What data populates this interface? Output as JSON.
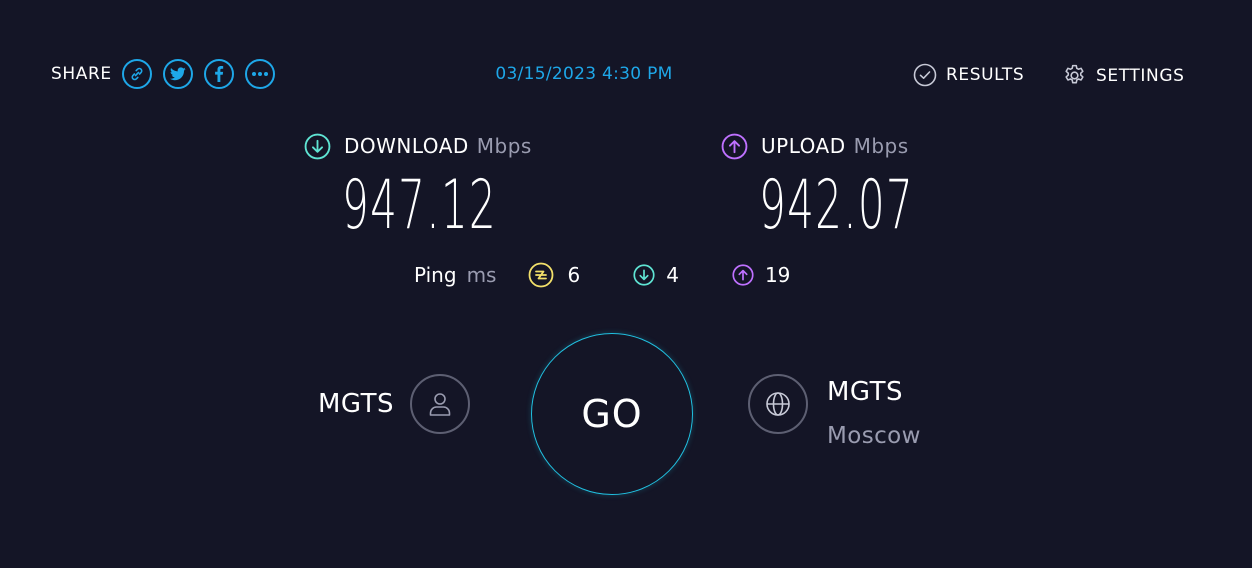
{
  "header": {
    "share_label": "SHARE",
    "share_buttons": [
      "link-icon",
      "twitter-icon",
      "facebook-icon",
      "more-icon"
    ],
    "datetime": "03/15/2023 4:30 PM",
    "results_label": "RESULTS",
    "settings_label": "SETTINGS"
  },
  "download": {
    "label": "DOWNLOAD",
    "unit": "Mbps",
    "value": "947.12",
    "icon": "arrow-down-circle-icon"
  },
  "upload": {
    "label": "UPLOAD",
    "unit": "Mbps",
    "value": "942.07",
    "icon": "arrow-up-circle-icon"
  },
  "ping": {
    "label": "Ping",
    "unit": "ms",
    "jitter": "6",
    "download": "4",
    "upload": "19"
  },
  "provider": {
    "name": "MGTS",
    "icon": "user-icon"
  },
  "go_label": "GO",
  "server": {
    "name": "MGTS",
    "city": "Moscow",
    "icon": "globe-icon"
  },
  "colors": {
    "background": "#141526",
    "accent_blue": "#1ea7e8",
    "download_teal": "#5fe4d3",
    "upload_purple": "#bf71ff",
    "ping_yellow": "#f2e06a",
    "muted_text": "#9a9cb0",
    "go_ring": "#21c0e0"
  }
}
